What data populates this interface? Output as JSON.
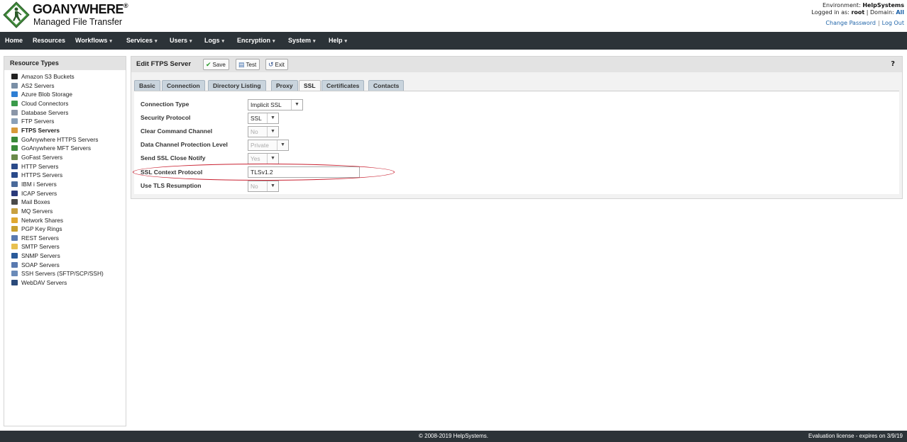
{
  "header": {
    "logo_go": "GO",
    "logo_anywhere": "ANYWHERE",
    "logo_reg": "®",
    "logo_subtitle": "Managed File Transfer",
    "env_label": "Environment:",
    "env_value": "HelpSystems",
    "logged_label": "Logged in as:",
    "logged_user": "root",
    "domain_label": "Domain:",
    "domain_value": "All",
    "change_password": "Change Password",
    "separator": "|",
    "logout": "Log Out"
  },
  "nav": [
    {
      "label": "Home",
      "dropdown": false
    },
    {
      "label": "Resources",
      "dropdown": false
    },
    {
      "label": "Workflows",
      "dropdown": true
    },
    {
      "label": "Services",
      "dropdown": true
    },
    {
      "label": "Users",
      "dropdown": true
    },
    {
      "label": "Logs",
      "dropdown": true
    },
    {
      "label": "Encryption",
      "dropdown": true
    },
    {
      "label": "System",
      "dropdown": true
    },
    {
      "label": "Help",
      "dropdown": true
    }
  ],
  "sidebar": {
    "title": "Resource Types",
    "items": [
      {
        "label": "Amazon S3 Buckets",
        "icon": "amazon-icon",
        "color": "#222222"
      },
      {
        "label": "AS2 Servers",
        "icon": "server-icon",
        "color": "#7a8fa6"
      },
      {
        "label": "Azure Blob Storage",
        "icon": "azure-icon",
        "color": "#2f7fd4"
      },
      {
        "label": "Cloud Connectors",
        "icon": "cloud-icon",
        "color": "#3a9a4a"
      },
      {
        "label": "Database Servers",
        "icon": "database-icon",
        "color": "#8a96a8"
      },
      {
        "label": "FTP Servers",
        "icon": "ftp-icon",
        "color": "#8aa0b8"
      },
      {
        "label": "FTPS Servers",
        "icon": "ftps-icon",
        "color": "#d89a3a",
        "active": true
      },
      {
        "label": "GoAnywhere HTTPS Servers",
        "icon": "goanywhere-icon",
        "color": "#3a8a3a"
      },
      {
        "label": "GoAnywhere MFT Servers",
        "icon": "goanywhere-icon",
        "color": "#3a8a3a"
      },
      {
        "label": "GoFast Servers",
        "icon": "gofast-icon",
        "color": "#6a8a4a"
      },
      {
        "label": "HTTP Servers",
        "icon": "monitor-icon",
        "color": "#2a4a8a"
      },
      {
        "label": "HTTPS Servers",
        "icon": "monitor-lock-icon",
        "color": "#2a4a8a"
      },
      {
        "label": "IBM i Servers",
        "icon": "ibm-icon",
        "color": "#4a6a9a"
      },
      {
        "label": "ICAP Servers",
        "icon": "shield-icon",
        "color": "#2a3a7a"
      },
      {
        "label": "Mail Boxes",
        "icon": "mailbox-icon",
        "color": "#4a4a4a"
      },
      {
        "label": "MQ Servers",
        "icon": "mq-icon",
        "color": "#c8a040"
      },
      {
        "label": "Network Shares",
        "icon": "folder-icon",
        "color": "#e0a830"
      },
      {
        "label": "PGP Key Rings",
        "icon": "key-icon",
        "color": "#c8a030"
      },
      {
        "label": "REST Servers",
        "icon": "rest-icon",
        "color": "#5a7ab0"
      },
      {
        "label": "SMTP Servers",
        "icon": "envelope-icon",
        "color": "#e8c050"
      },
      {
        "label": "SNMP Servers",
        "icon": "snmp-icon",
        "color": "#2a5a9a"
      },
      {
        "label": "SOAP Servers",
        "icon": "soap-icon",
        "color": "#5a7ab0"
      },
      {
        "label": "SSH Servers (SFTP/SCP/SSH)",
        "icon": "ssh-icon",
        "color": "#6a8ab8"
      },
      {
        "label": "WebDAV Servers",
        "icon": "webdav-icon",
        "color": "#2a4a7a"
      }
    ]
  },
  "panel": {
    "title": "Edit FTPS Server",
    "save": "Save",
    "test": "Test",
    "exit": "Exit",
    "help": "?"
  },
  "tabs": [
    "Basic",
    "Connection",
    "Directory Listing",
    "Proxy",
    "SSL",
    "Certificates",
    "Contacts"
  ],
  "active_tab": "SSL",
  "form": {
    "connection_type": {
      "label": "Connection Type",
      "value": "Implicit SSL",
      "disabled": false
    },
    "security_protocol": {
      "label": "Security Protocol",
      "value": "SSL",
      "disabled": false
    },
    "clear_command_channel": {
      "label": "Clear Command Channel",
      "value": "No",
      "disabled": true
    },
    "data_channel_protection": {
      "label": "Data Channel Protection Level",
      "value": "Private",
      "disabled": true
    },
    "send_ssl_close_notify": {
      "label": "Send SSL Close Notify",
      "value": "Yes",
      "disabled": true
    },
    "ssl_context_protocol": {
      "label": "SSL Context Protocol",
      "value": "TLSv1.2"
    },
    "use_tls_resumption": {
      "label": "Use TLS Resumption",
      "value": "No",
      "disabled": true
    }
  },
  "footer": {
    "copyright": "© 2008-2019 HelpSystems.",
    "license": "Evaluation license - expires on 3/9/19"
  },
  "colors": {
    "navbar": "#2c3338",
    "highlight": "#c92030",
    "brand_green": "#3f8a3a"
  }
}
